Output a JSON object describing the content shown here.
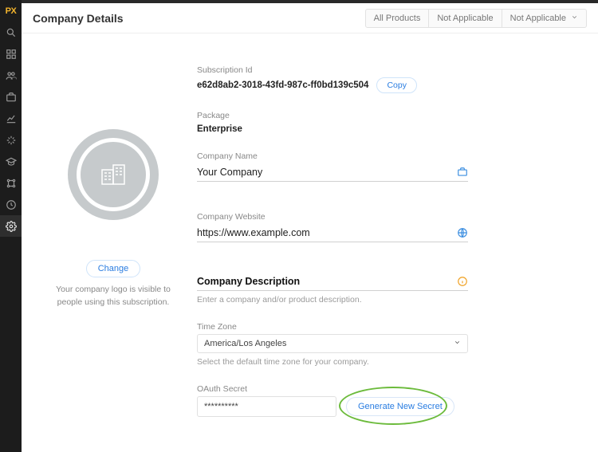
{
  "brand": "PX",
  "page_title": "Company Details",
  "header_tabs": [
    "All Products",
    "Not Applicable",
    "Not Applicable"
  ],
  "sidebar_icons": [
    "search",
    "dashboard",
    "users",
    "briefcase",
    "chart",
    "trend",
    "graduation",
    "hierarchy",
    "clock",
    "settings"
  ],
  "logo": {
    "change_label": "Change",
    "caption": "Your company logo is visible to people using this subscription."
  },
  "fields": {
    "subscription": {
      "label": "Subscription Id",
      "value": "e62d8ab2-3018-43fd-987c-ff0bd139c504",
      "copy_label": "Copy"
    },
    "package": {
      "label": "Package",
      "value": "Enterprise"
    },
    "company_name": {
      "label": "Company Name",
      "value": "Your Company"
    },
    "website": {
      "label": "Company Website",
      "value": "https://www.example.com"
    },
    "description": {
      "label": "Company Description",
      "value": "",
      "placeholder": "Enter a company and/or product description."
    },
    "timezone": {
      "label": "Time Zone",
      "value": "America/Los Angeles",
      "help": "Select the default time zone for your company."
    },
    "oauth": {
      "label": "OAuth Secret",
      "value": "**********",
      "button": "Generate New Secret"
    }
  }
}
